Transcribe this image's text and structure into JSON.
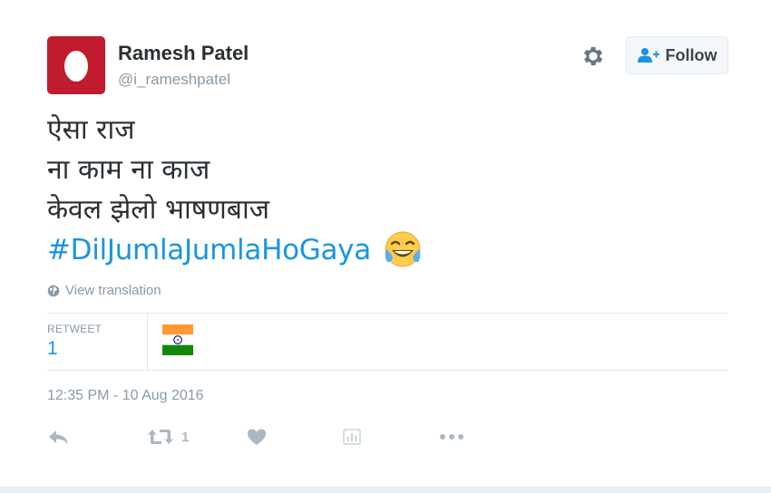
{
  "user": {
    "name": "Ramesh Patel",
    "handle": "@i_rameshpatel",
    "avatar_color": "#c01b2e"
  },
  "header": {
    "settings_icon": "gear-icon",
    "follow_label": "Follow",
    "follow_icon": "add-user-icon"
  },
  "tweet": {
    "lines": [
      "ऐसा राज",
      "ना काम ना काज",
      "केवल झेलो भाषणबाज"
    ],
    "hashtag": "#DilJumlaJumlaHoGaya",
    "emoji": "face-with-tears-of-joy",
    "view_translation": "View translation"
  },
  "stats": {
    "retweet_label": "RETWEET",
    "retweet_count": "1"
  },
  "timestamp": "12:35 PM - 10 Aug 2016",
  "actions": {
    "reply_icon": "reply-icon",
    "retweet_icon": "retweet-icon",
    "retweet_count": "1",
    "like_icon": "heart-icon",
    "analytics_icon": "analytics-icon",
    "more_icon": "more-icon"
  },
  "colors": {
    "link": "#1b95e0",
    "muted": "#8899a6",
    "action_gray": "#aab8c2",
    "border": "#e1e8ed"
  }
}
